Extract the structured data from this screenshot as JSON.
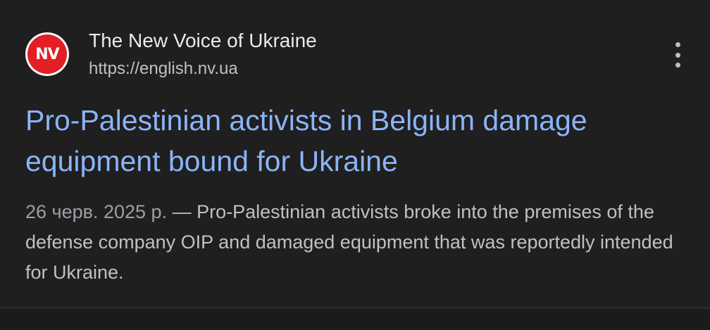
{
  "result": {
    "favicon_text": "NV",
    "source_name": "The New Voice of Ukraine",
    "source_url": "https://english.nv.ua",
    "more_icon": "more-vert-icon",
    "title": "Pro-Palestinian activists in Belgium damage equipment bound for Ukraine",
    "date": "26 черв. 2025 р.",
    "separator": " — ",
    "snippet": "Pro-Palestinian activists broke into the premises of the defense company OIP and damaged equipment that was reportedly intended for Ukraine."
  },
  "colors": {
    "background": "#1f1f1f",
    "title_link": "#8ab4f8",
    "favicon_red": "#e31e24"
  }
}
